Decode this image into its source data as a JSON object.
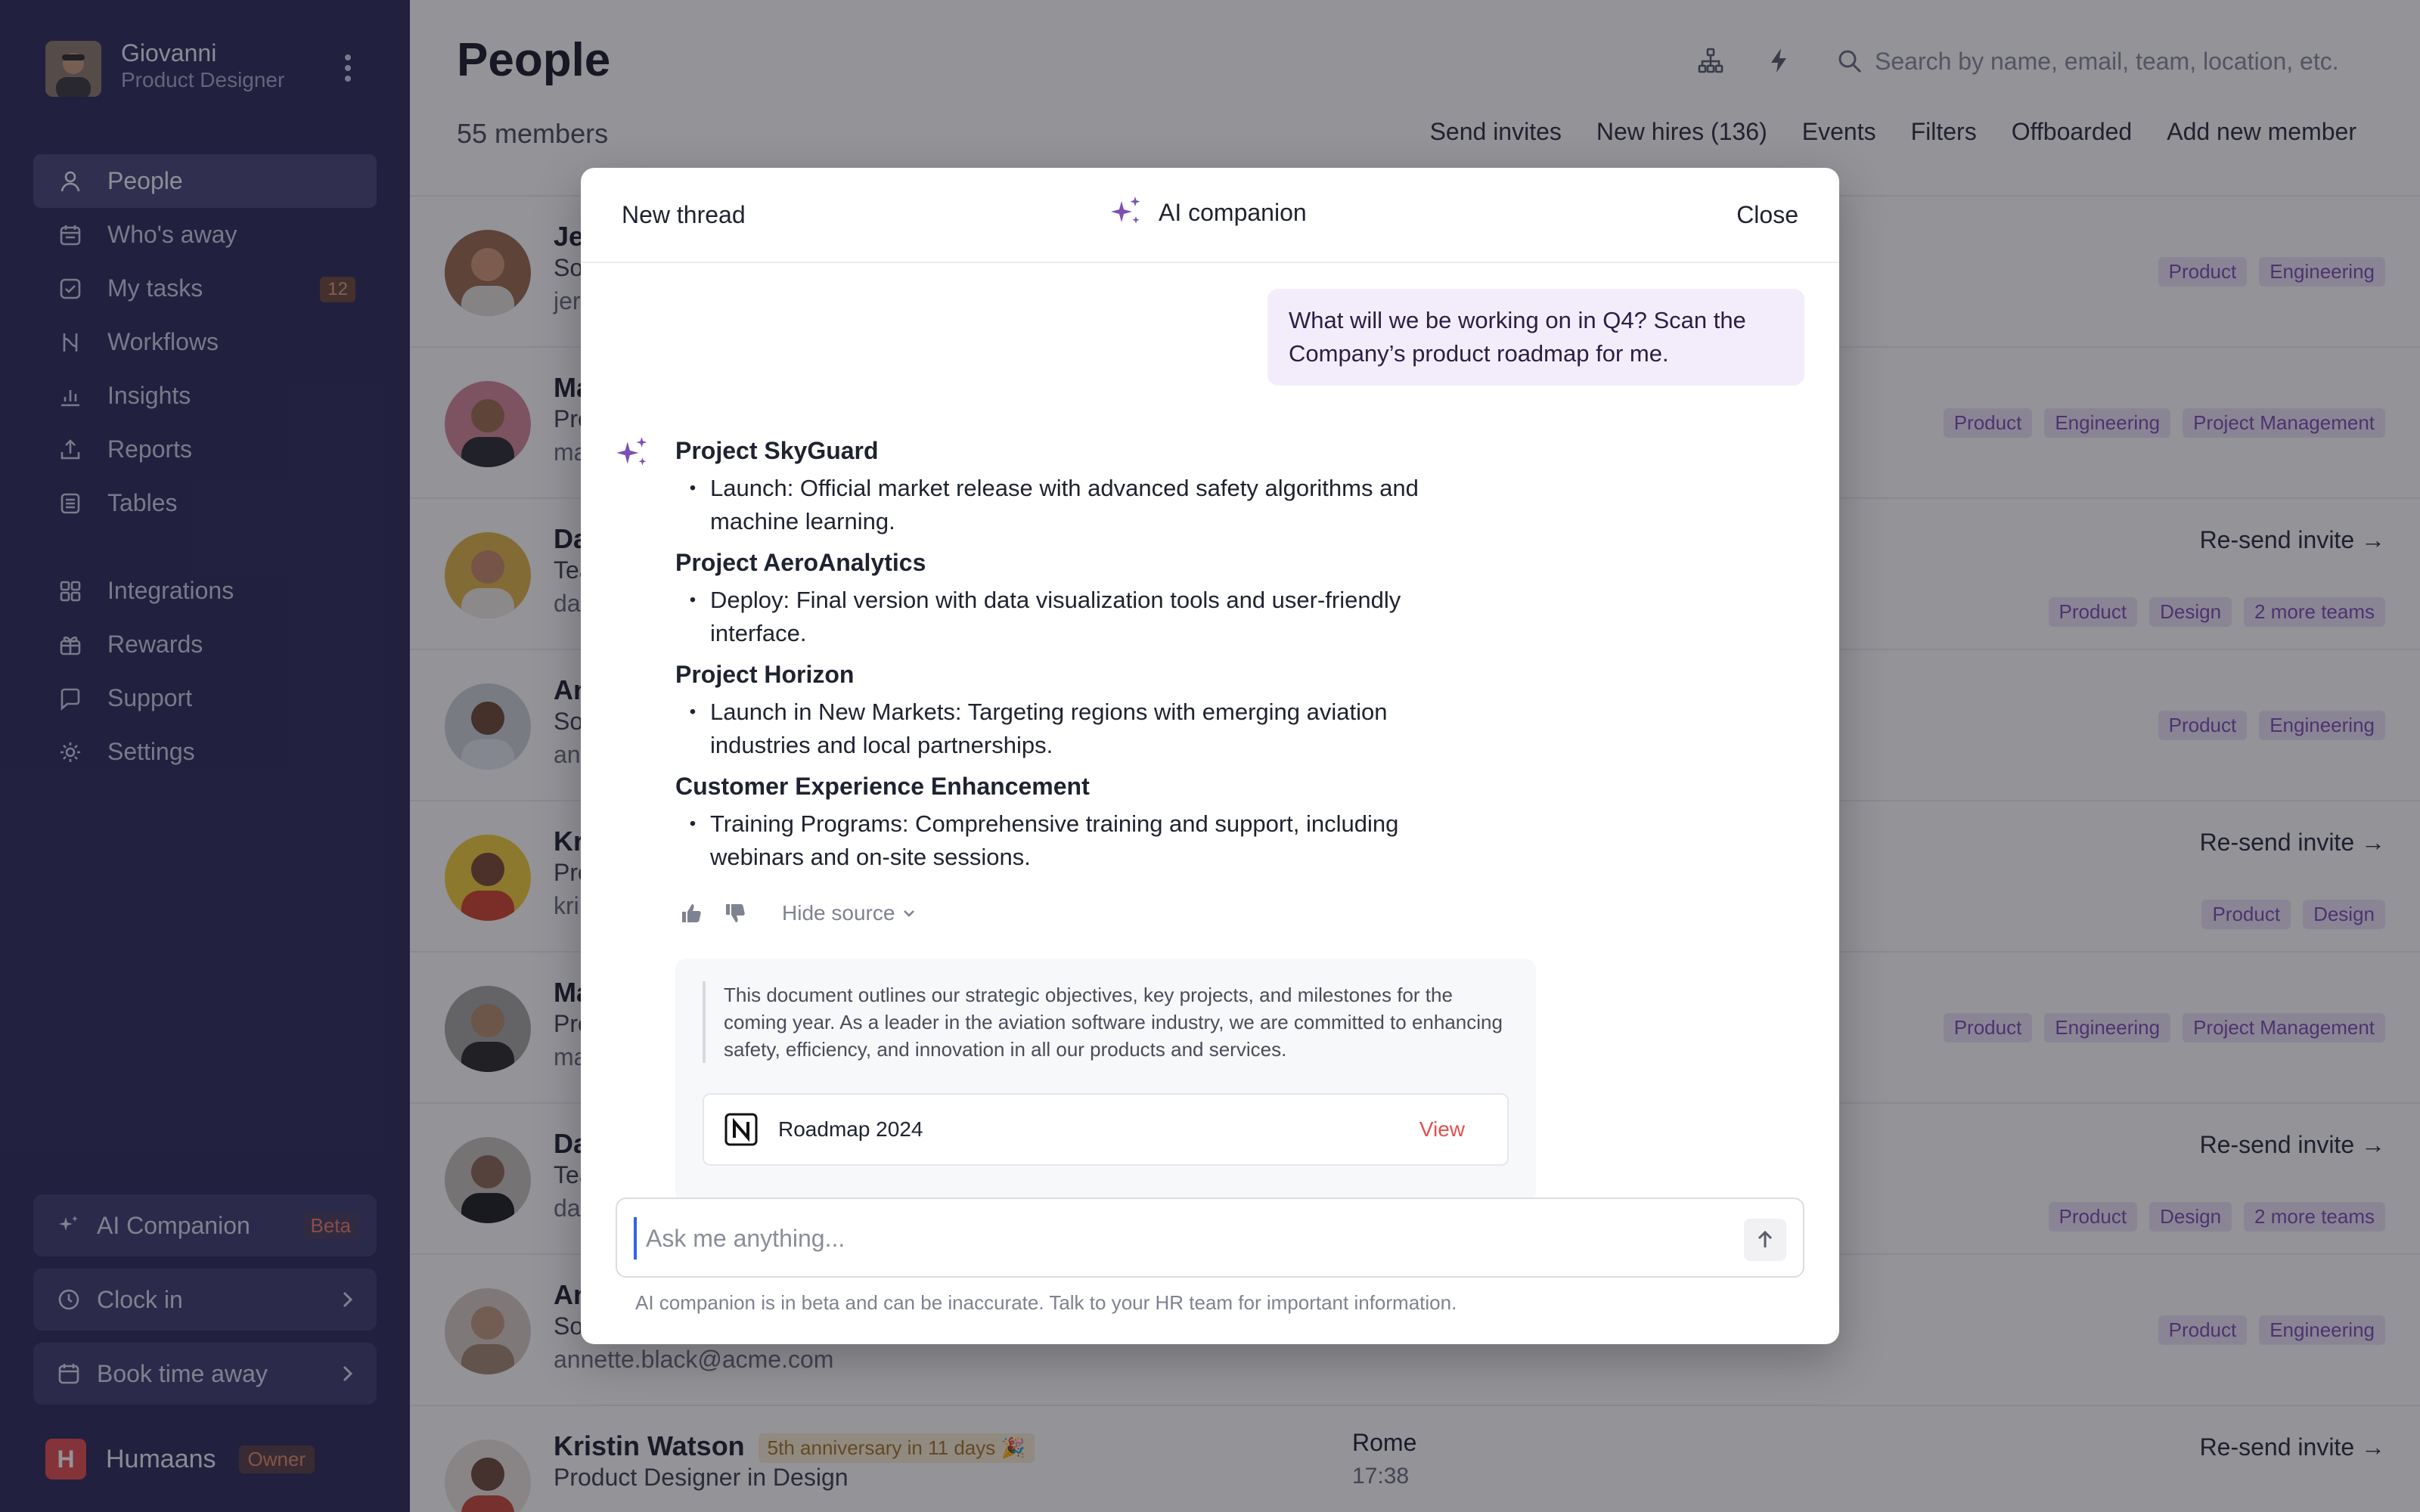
{
  "user": {
    "name": "Giovanni",
    "role": "Product Designer"
  },
  "nav": {
    "items": [
      {
        "label": "People",
        "icon": "person-icon",
        "active": true
      },
      {
        "label": "Who's away",
        "icon": "calendar-icon"
      },
      {
        "label": "My tasks",
        "icon": "checkbox-icon",
        "badge": "12"
      },
      {
        "label": "Workflows",
        "icon": "workflow-icon"
      },
      {
        "label": "Insights",
        "icon": "bar-chart-icon"
      },
      {
        "label": "Reports",
        "icon": "upload-icon"
      },
      {
        "label": "Tables",
        "icon": "table-icon"
      }
    ],
    "items2": [
      {
        "label": "Integrations",
        "icon": "grid-icon"
      },
      {
        "label": "Rewards",
        "icon": "gift-icon"
      },
      {
        "label": "Support",
        "icon": "chat-icon"
      },
      {
        "label": "Settings",
        "icon": "gear-icon"
      }
    ]
  },
  "sidebar_bottom": {
    "ai_companion": "AI Companion",
    "beta": "Beta",
    "clock_in": "Clock in",
    "book_time_away": "Book time away",
    "brand_letter": "H",
    "brand_name": "Humaans",
    "owner": "Owner"
  },
  "header": {
    "title": "People",
    "members": "55 members",
    "search_placeholder": "Search by name, email, team, location, etc.",
    "actions": [
      "Send invites",
      "New hires (136)",
      "Events",
      "Filters",
      "Offboarded",
      "Add new member"
    ]
  },
  "rows": [
    {
      "name": "Je",
      "role": "So",
      "email": "jer",
      "tags": [
        "Product",
        "Engineering"
      ]
    },
    {
      "name": "Ma",
      "role": "Pro",
      "email": "ma",
      "tags": [
        "Product",
        "Engineering",
        "Project Management"
      ]
    },
    {
      "name": "Da",
      "role": "Tea",
      "email": "da",
      "resend": "Re-send invite →",
      "tags": [
        "Product",
        "Design",
        "2 more teams"
      ]
    },
    {
      "name": "An",
      "role": "So",
      "email": "an",
      "tags": [
        "Product",
        "Engineering"
      ]
    },
    {
      "name": "Kr",
      "role": "Pro",
      "email": "kri",
      "resend": "Re-send invite →",
      "tags": [
        "Product",
        "Design"
      ]
    },
    {
      "name": "Ma",
      "role": "Pro",
      "email": "ma",
      "tags": [
        "Product",
        "Engineering",
        "Project Management"
      ]
    },
    {
      "name": "Da",
      "role": "Tea",
      "email": "da",
      "resend": "Re-send invite →",
      "tags": [
        "Product",
        "Design",
        "2 more teams"
      ]
    },
    {
      "name": "An",
      "role": "So",
      "email": "annette.black@acme.com",
      "tags": [
        "Product",
        "Engineering"
      ]
    },
    {
      "name": "Kristin Watson",
      "anniversary": "5th anniversary in 11 days 🎉",
      "role": "Product Designer in Design",
      "city": "Rome",
      "time": "17:38",
      "resend": "Re-send invite →"
    }
  ],
  "modal": {
    "new_thread": "New thread",
    "title": "AI companion",
    "close": "Close",
    "user_message": "What will we be working on in Q4? Scan the Company’s product roadmap for me.",
    "projects": [
      {
        "title": "Project SkyGuard",
        "bullet": "Launch: Official market release with advanced safety algorithms and machine learning."
      },
      {
        "title": "Project AeroAnalytics",
        "bullet": "Deploy: Final version with data visualization tools and user-friendly interface."
      },
      {
        "title": "Project Horizon",
        "bullet": "Launch in New Markets: Targeting regions with emerging aviation industries and local partnerships."
      },
      {
        "title": "Customer Experience Enhancement",
        "bullet": "Training Programs: Comprehensive training and support, including webinars and on-site sessions."
      }
    ],
    "hide_source": "Hide source",
    "source_quote": "This document outlines our strategic objectives, key projects, and milestones for the coming year. As a leader in the aviation software industry, we are committed to enhancing safety, efficiency, and innovation in all our products and services.",
    "doc_title": "Roadmap 2024",
    "view": "View",
    "input_placeholder": "Ask me anything...",
    "disclaimer": "AI companion is in beta and can be inaccurate. Talk to your HR team for important information."
  },
  "colors": {
    "sidebar": "#2e2c5c",
    "accent": "#7e4fb4",
    "tag_bg": "#efe6f9",
    "danger": "#e2504b"
  }
}
